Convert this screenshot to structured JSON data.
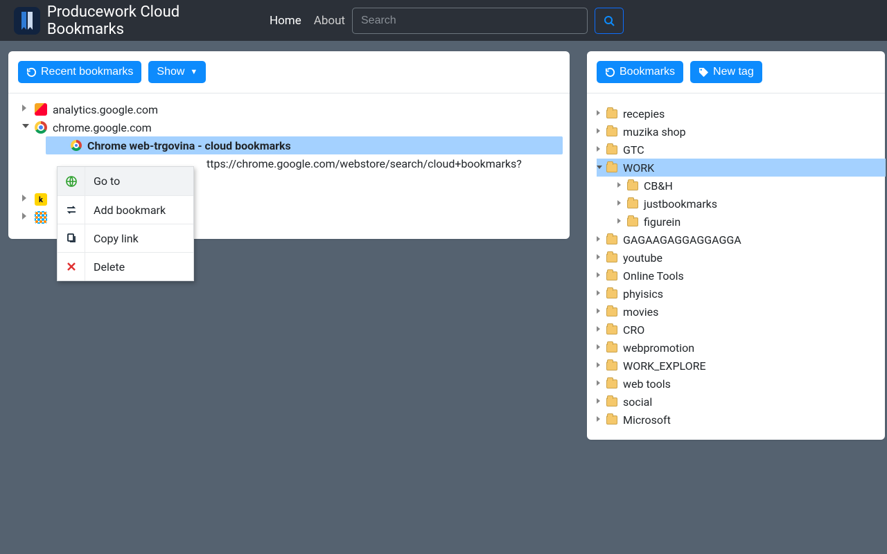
{
  "navbar": {
    "brand": "Producework Cloud Bookmarks",
    "links": {
      "home": "Home",
      "about": "About"
    },
    "search_placeholder": "Search"
  },
  "left_panel": {
    "recent_btn": "Recent bookmarks",
    "show_btn": "Show",
    "tree": {
      "analytics": "analytics.google.com",
      "chrome": "chrome.google.com",
      "selected_title": "Chrome web-trgovina - cloud bookmarks",
      "selected_url": "ttps://chrome.google.com/webstore/search/cloud+bookmarks?"
    }
  },
  "context_menu": {
    "goto": "Go to",
    "add": "Add bookmark",
    "copy": "Copy link",
    "delete": "Delete"
  },
  "right_panel": {
    "bookmarks_btn": "Bookmarks",
    "newtag_btn": "New tag",
    "tags": {
      "recepies": "recepies",
      "muzika": "muzika shop",
      "gtc": "GTC",
      "work": "WORK",
      "cbh": "CB&H",
      "justbookmarks": "justbookmarks",
      "figurein": "figurein",
      "gaga": "GAGAAGAGGAGGAGGA",
      "youtube": "youtube",
      "onlinetools": "Online Tools",
      "phyisics": "phyisics",
      "movies": "movies",
      "cro": "CRO",
      "webpromotion": "webpromotion",
      "workexplore": "WORK_EXPLORE",
      "webtools": "web tools",
      "social": "social",
      "microsoft": "Microsoft"
    }
  }
}
